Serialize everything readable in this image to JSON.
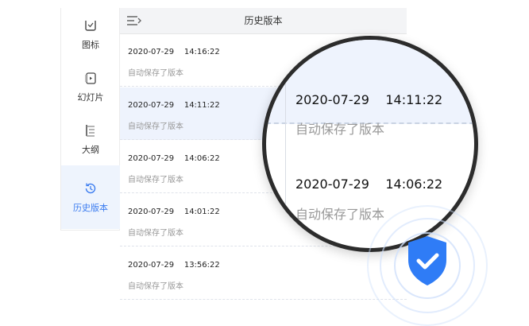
{
  "sidebar": {
    "items": [
      {
        "label": "图标",
        "icon": "icon-library-icon",
        "active": false
      },
      {
        "label": "幻灯片",
        "icon": "slides-icon",
        "active": false
      },
      {
        "label": "大纲",
        "icon": "outline-icon",
        "active": false
      },
      {
        "label": "历史版本",
        "icon": "history-icon",
        "active": true
      }
    ]
  },
  "header": {
    "title": "历史版本",
    "collapse_icon": "collapse-menu-icon"
  },
  "versions": [
    {
      "timestamp": "2020-07-29    14:16:22",
      "note": "自动保存了版本"
    },
    {
      "timestamp": "2020-07-29    14:11:22",
      "note": "自动保存了版本"
    },
    {
      "timestamp": "2020-07-29    14:06:22",
      "note": "自动保存了版本"
    },
    {
      "timestamp": "2020-07-29    14:01:22",
      "note": "自动保存了版本"
    },
    {
      "timestamp": "2020-07-29    13:56:22",
      "note": "自动保存了版本"
    }
  ],
  "magnified": [
    {
      "timestamp": "2020-07-29    14:11:22",
      "note": "自动保存了版本"
    },
    {
      "timestamp": "2020-07-29    14:06:22",
      "note": "自动保存了版本"
    }
  ],
  "colors": {
    "accent": "#3b7cf0",
    "active_bg": "#eef3fd",
    "shield": "#2f7cf6"
  },
  "badge_icon": "shield-check-icon"
}
